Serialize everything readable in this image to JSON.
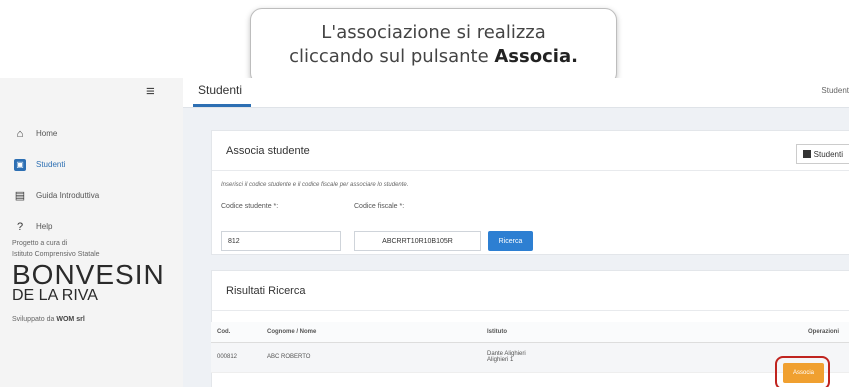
{
  "caption": {
    "line1": "L'associazione si realizza",
    "line2_prefix": "cliccando sul pulsante ",
    "line2_bold": "Associa."
  },
  "sidebar": {
    "menu_icon": "hamburger-icon",
    "items": [
      {
        "label": "Home",
        "icon": "home-icon"
      },
      {
        "label": "Studenti",
        "icon": "students-icon",
        "active": true
      },
      {
        "label": "Guida Introduttiva",
        "icon": "document-icon"
      },
      {
        "label": "Help",
        "icon": "help-icon"
      }
    ],
    "project_line1": "Progetto a cura di",
    "project_line2": "Istituto Comprensivo Statale",
    "logo_line1": "BONVESIN",
    "logo_line2": "DE LA RIVA",
    "developed_by_prefix": "Sviluppato da ",
    "developed_by_name": "WOM srl"
  },
  "header": {
    "title": "Studenti",
    "breadcrumb": "Student"
  },
  "associa_panel": {
    "title": "Associa studente",
    "studenti_button": "Studenti",
    "hint": "Inserisci il codice studente e il codice fiscale per associare lo studente.",
    "codice_studente_label": "Codice studente *:",
    "codice_studente_value": "812",
    "codice_fiscale_label": "Codice fiscale *:",
    "codice_fiscale_value": "ABCRRT10R10B105R",
    "ricerca_button": "Ricerca"
  },
  "results_panel": {
    "title": "Risultati Ricerca",
    "columns": [
      "Cod.",
      "Cognome / Nome",
      "Istituto",
      "Operazioni"
    ],
    "rows": [
      {
        "cod": "000812",
        "nome": "ABC ROBERTO",
        "istituto_line1": "Dante Alighieri",
        "istituto_line2": "Alighieri 1",
        "action": "Associa"
      }
    ]
  },
  "colors": {
    "accent": "#2d6fb3",
    "associa_button": "#f0a030",
    "highlight": "#c0241f"
  }
}
